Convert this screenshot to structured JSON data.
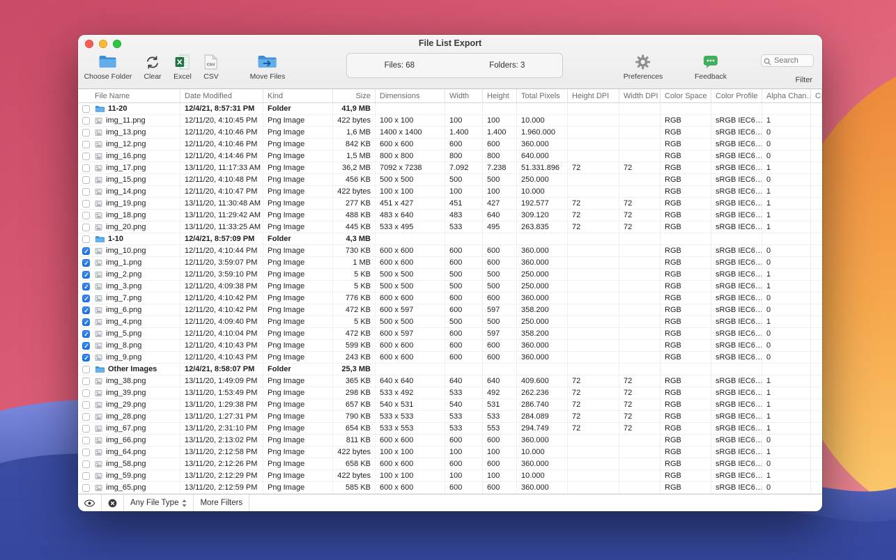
{
  "window": {
    "title": "File List Export",
    "toolbar": {
      "buttons": [
        {
          "label": "Choose Folder",
          "icon": "blue-folder-icon"
        },
        {
          "label": "Clear",
          "icon": "refresh-arrows-icon"
        },
        {
          "label": "Excel",
          "icon": "excel-document-icon"
        },
        {
          "label": "CSV",
          "icon": "csv-document-icon"
        },
        {
          "label": "Move Files",
          "icon": "blue-folder-arrow-icon"
        }
      ],
      "stats": {
        "files": "Files: 68",
        "folders": "Folders: 3"
      },
      "right_buttons": [
        {
          "label": "Preferences",
          "icon": "gear-icon"
        },
        {
          "label": "Feedback",
          "icon": "feedback-bubble-icon"
        }
      ],
      "search": {
        "placeholder": "Search",
        "icon": "magnifier-icon"
      },
      "filter_label": "Filter"
    },
    "table": {
      "columns": [
        "File Name",
        "Date Modified",
        "Kind",
        "Size",
        "Dimensions",
        "Width",
        "Height",
        "Total Pixels",
        "Height DPI",
        "Width DPI",
        "Color Space",
        "Color Profile",
        "Alpha Chan…",
        "Cr…"
      ],
      "rows": [
        {
          "type": "folder",
          "checked": false,
          "name": "11-20",
          "date": "12/4/21, 8:57:31 PM",
          "kind": "Folder",
          "size": "41,9 MB",
          "dim": "",
          "w": "",
          "h": "",
          "px": "",
          "hdpi": "",
          "wdpi": "",
          "cs": "",
          "cp": "",
          "alpha": ""
        },
        {
          "type": "file",
          "checked": false,
          "name": "img_11.png",
          "date": "12/11/20, 4:10:45 PM",
          "kind": "Png Image",
          "size": "422 bytes",
          "dim": "100 x 100",
          "w": "100",
          "h": "100",
          "px": "10.000",
          "hdpi": "",
          "wdpi": "",
          "cs": "RGB",
          "cp": "sRGB IEC6…",
          "alpha": "1"
        },
        {
          "type": "file",
          "checked": false,
          "name": "img_13.png",
          "date": "12/11/20, 4:10:46 PM",
          "kind": "Png Image",
          "size": "1,6 MB",
          "dim": "1400 x 1400",
          "w": "1.400",
          "h": "1.400",
          "px": "1.960.000",
          "hdpi": "",
          "wdpi": "",
          "cs": "RGB",
          "cp": "sRGB IEC6…",
          "alpha": "0"
        },
        {
          "type": "file",
          "checked": false,
          "name": "img_12.png",
          "date": "12/11/20, 4:10:46 PM",
          "kind": "Png Image",
          "size": "842 KB",
          "dim": "600 x 600",
          "w": "600",
          "h": "600",
          "px": "360.000",
          "hdpi": "",
          "wdpi": "",
          "cs": "RGB",
          "cp": "sRGB IEC6…",
          "alpha": "0"
        },
        {
          "type": "file",
          "checked": false,
          "name": "img_16.png",
          "date": "12/11/20, 4:14:46 PM",
          "kind": "Png Image",
          "size": "1,5 MB",
          "dim": "800 x 800",
          "w": "800",
          "h": "800",
          "px": "640.000",
          "hdpi": "",
          "wdpi": "",
          "cs": "RGB",
          "cp": "sRGB IEC6…",
          "alpha": "0"
        },
        {
          "type": "file",
          "checked": false,
          "name": "img_17.png",
          "date": "13/11/20, 11:17:33 AM",
          "kind": "Png Image",
          "size": "36,2 MB",
          "dim": "7092 x 7238",
          "w": "7.092",
          "h": "7.238",
          "px": "51.331.896",
          "hdpi": "72",
          "wdpi": "72",
          "cs": "RGB",
          "cp": "sRGB IEC6…",
          "alpha": "1"
        },
        {
          "type": "file",
          "checked": false,
          "name": "img_15.png",
          "date": "12/11/20, 4:10:48 PM",
          "kind": "Png Image",
          "size": "456 KB",
          "dim": "500 x 500",
          "w": "500",
          "h": "500",
          "px": "250.000",
          "hdpi": "",
          "wdpi": "",
          "cs": "RGB",
          "cp": "sRGB IEC6…",
          "alpha": "0"
        },
        {
          "type": "file",
          "checked": false,
          "name": "img_14.png",
          "date": "12/11/20, 4:10:47 PM",
          "kind": "Png Image",
          "size": "422 bytes",
          "dim": "100 x 100",
          "w": "100",
          "h": "100",
          "px": "10.000",
          "hdpi": "",
          "wdpi": "",
          "cs": "RGB",
          "cp": "sRGB IEC6…",
          "alpha": "1"
        },
        {
          "type": "file",
          "checked": false,
          "name": "img_19.png",
          "date": "13/11/20, 11:30:48 AM",
          "kind": "Png Image",
          "size": "277 KB",
          "dim": "451 x 427",
          "w": "451",
          "h": "427",
          "px": "192.577",
          "hdpi": "72",
          "wdpi": "72",
          "cs": "RGB",
          "cp": "sRGB IEC6…",
          "alpha": "1"
        },
        {
          "type": "file",
          "checked": false,
          "name": "img_18.png",
          "date": "13/11/20, 11:29:42 AM",
          "kind": "Png Image",
          "size": "488 KB",
          "dim": "483 x 640",
          "w": "483",
          "h": "640",
          "px": "309.120",
          "hdpi": "72",
          "wdpi": "72",
          "cs": "RGB",
          "cp": "sRGB IEC6…",
          "alpha": "1"
        },
        {
          "type": "file",
          "checked": false,
          "name": "img_20.png",
          "date": "13/11/20, 11:33:25 AM",
          "kind": "Png Image",
          "size": "445 KB",
          "dim": "533 x 495",
          "w": "533",
          "h": "495",
          "px": "263.835",
          "hdpi": "72",
          "wdpi": "72",
          "cs": "RGB",
          "cp": "sRGB IEC6…",
          "alpha": "1"
        },
        {
          "type": "folder",
          "checked": false,
          "name": "1-10",
          "date": "12/4/21, 8:57:09 PM",
          "kind": "Folder",
          "size": "4,3 MB",
          "dim": "",
          "w": "",
          "h": "",
          "px": "",
          "hdpi": "",
          "wdpi": "",
          "cs": "",
          "cp": "",
          "alpha": ""
        },
        {
          "type": "file",
          "checked": true,
          "name": "img_10.png",
          "date": "12/11/20, 4:10:44 PM",
          "kind": "Png Image",
          "size": "730 KB",
          "dim": "600 x 600",
          "w": "600",
          "h": "600",
          "px": "360.000",
          "hdpi": "",
          "wdpi": "",
          "cs": "RGB",
          "cp": "sRGB IEC6…",
          "alpha": "0"
        },
        {
          "type": "file",
          "checked": true,
          "name": "img_1.png",
          "date": "12/11/20, 3:59:07 PM",
          "kind": "Png Image",
          "size": "1 MB",
          "dim": "600 x 600",
          "w": "600",
          "h": "600",
          "px": "360.000",
          "hdpi": "",
          "wdpi": "",
          "cs": "RGB",
          "cp": "sRGB IEC6…",
          "alpha": "0"
        },
        {
          "type": "file",
          "checked": true,
          "name": "img_2.png",
          "date": "12/11/20, 3:59:10 PM",
          "kind": "Png Image",
          "size": "5 KB",
          "dim": "500 x 500",
          "w": "500",
          "h": "500",
          "px": "250.000",
          "hdpi": "",
          "wdpi": "",
          "cs": "RGB",
          "cp": "sRGB IEC6…",
          "alpha": "1"
        },
        {
          "type": "file",
          "checked": true,
          "name": "img_3.png",
          "date": "12/11/20, 4:09:38 PM",
          "kind": "Png Image",
          "size": "5 KB",
          "dim": "500 x 500",
          "w": "500",
          "h": "500",
          "px": "250.000",
          "hdpi": "",
          "wdpi": "",
          "cs": "RGB",
          "cp": "sRGB IEC6…",
          "alpha": "1"
        },
        {
          "type": "file",
          "checked": true,
          "name": "img_7.png",
          "date": "12/11/20, 4:10:42 PM",
          "kind": "Png Image",
          "size": "776 KB",
          "dim": "600 x 600",
          "w": "600",
          "h": "600",
          "px": "360.000",
          "hdpi": "",
          "wdpi": "",
          "cs": "RGB",
          "cp": "sRGB IEC6…",
          "alpha": "0"
        },
        {
          "type": "file",
          "checked": true,
          "name": "img_6.png",
          "date": "12/11/20, 4:10:42 PM",
          "kind": "Png Image",
          "size": "472 KB",
          "dim": "600 x 597",
          "w": "600",
          "h": "597",
          "px": "358.200",
          "hdpi": "",
          "wdpi": "",
          "cs": "RGB",
          "cp": "sRGB IEC6…",
          "alpha": "0"
        },
        {
          "type": "file",
          "checked": true,
          "name": "img_4.png",
          "date": "12/11/20, 4:09:40 PM",
          "kind": "Png Image",
          "size": "5 KB",
          "dim": "500 x 500",
          "w": "500",
          "h": "500",
          "px": "250.000",
          "hdpi": "",
          "wdpi": "",
          "cs": "RGB",
          "cp": "sRGB IEC6…",
          "alpha": "1"
        },
        {
          "type": "file",
          "checked": true,
          "name": "img_5.png",
          "date": "12/11/20, 4:10:04 PM",
          "kind": "Png Image",
          "size": "472 KB",
          "dim": "600 x 597",
          "w": "600",
          "h": "597",
          "px": "358.200",
          "hdpi": "",
          "wdpi": "",
          "cs": "RGB",
          "cp": "sRGB IEC6…",
          "alpha": "0"
        },
        {
          "type": "file",
          "checked": true,
          "name": "img_8.png",
          "date": "12/11/20, 4:10:43 PM",
          "kind": "Png Image",
          "size": "599 KB",
          "dim": "600 x 600",
          "w": "600",
          "h": "600",
          "px": "360.000",
          "hdpi": "",
          "wdpi": "",
          "cs": "RGB",
          "cp": "sRGB IEC6…",
          "alpha": "0"
        },
        {
          "type": "file",
          "checked": true,
          "name": "img_9.png",
          "date": "12/11/20, 4:10:43 PM",
          "kind": "Png Image",
          "size": "243 KB",
          "dim": "600 x 600",
          "w": "600",
          "h": "600",
          "px": "360.000",
          "hdpi": "",
          "wdpi": "",
          "cs": "RGB",
          "cp": "sRGB IEC6…",
          "alpha": "0"
        },
        {
          "type": "folder",
          "checked": false,
          "name": "Other Images",
          "date": "12/4/21, 8:58:07 PM",
          "kind": "Folder",
          "size": "25,3 MB",
          "dim": "",
          "w": "",
          "h": "",
          "px": "",
          "hdpi": "",
          "wdpi": "",
          "cs": "",
          "cp": "",
          "alpha": ""
        },
        {
          "type": "file",
          "checked": false,
          "name": "img_38.png",
          "date": "13/11/20, 1:49:09 PM",
          "kind": "Png Image",
          "size": "365 KB",
          "dim": "640 x 640",
          "w": "640",
          "h": "640",
          "px": "409.600",
          "hdpi": "72",
          "wdpi": "72",
          "cs": "RGB",
          "cp": "sRGB IEC6…",
          "alpha": "1"
        },
        {
          "type": "file",
          "checked": false,
          "name": "img_39.png",
          "date": "13/11/20, 1:53:49 PM",
          "kind": "Png Image",
          "size": "298 KB",
          "dim": "533 x 492",
          "w": "533",
          "h": "492",
          "px": "262.236",
          "hdpi": "72",
          "wdpi": "72",
          "cs": "RGB",
          "cp": "sRGB IEC6…",
          "alpha": "1"
        },
        {
          "type": "file",
          "checked": false,
          "name": "img_29.png",
          "date": "13/11/20, 1:29:38 PM",
          "kind": "Png Image",
          "size": "657 KB",
          "dim": "540 x 531",
          "w": "540",
          "h": "531",
          "px": "286.740",
          "hdpi": "72",
          "wdpi": "72",
          "cs": "RGB",
          "cp": "sRGB IEC6…",
          "alpha": "1"
        },
        {
          "type": "file",
          "checked": false,
          "name": "img_28.png",
          "date": "13/11/20, 1:27:31 PM",
          "kind": "Png Image",
          "size": "790 KB",
          "dim": "533 x 533",
          "w": "533",
          "h": "533",
          "px": "284.089",
          "hdpi": "72",
          "wdpi": "72",
          "cs": "RGB",
          "cp": "sRGB IEC6…",
          "alpha": "1"
        },
        {
          "type": "file",
          "checked": false,
          "name": "img_67.png",
          "date": "13/11/20, 2:31:10 PM",
          "kind": "Png Image",
          "size": "654 KB",
          "dim": "533 x 553",
          "w": "533",
          "h": "553",
          "px": "294.749",
          "hdpi": "72",
          "wdpi": "72",
          "cs": "RGB",
          "cp": "sRGB IEC6…",
          "alpha": "1"
        },
        {
          "type": "file",
          "checked": false,
          "name": "img_66.png",
          "date": "13/11/20, 2:13:02 PM",
          "kind": "Png Image",
          "size": "811 KB",
          "dim": "600 x 600",
          "w": "600",
          "h": "600",
          "px": "360.000",
          "hdpi": "",
          "wdpi": "",
          "cs": "RGB",
          "cp": "sRGB IEC6…",
          "alpha": "0"
        },
        {
          "type": "file",
          "checked": false,
          "name": "img_64.png",
          "date": "13/11/20, 2:12:58 PM",
          "kind": "Png Image",
          "size": "422 bytes",
          "dim": "100 x 100",
          "w": "100",
          "h": "100",
          "px": "10.000",
          "hdpi": "",
          "wdpi": "",
          "cs": "RGB",
          "cp": "sRGB IEC6…",
          "alpha": "1"
        },
        {
          "type": "file",
          "checked": false,
          "name": "img_58.png",
          "date": "13/11/20, 2:12:26 PM",
          "kind": "Png Image",
          "size": "658 KB",
          "dim": "600 x 600",
          "w": "600",
          "h": "600",
          "px": "360.000",
          "hdpi": "",
          "wdpi": "",
          "cs": "RGB",
          "cp": "sRGB IEC6…",
          "alpha": "0"
        },
        {
          "type": "file",
          "checked": false,
          "name": "img_59.png",
          "date": "13/11/20, 2:12:29 PM",
          "kind": "Png Image",
          "size": "422 bytes",
          "dim": "100 x 100",
          "w": "100",
          "h": "100",
          "px": "10.000",
          "hdpi": "",
          "wdpi": "",
          "cs": "RGB",
          "cp": "sRGB IEC6…",
          "alpha": "1"
        },
        {
          "type": "file",
          "checked": false,
          "name": "img_65.png",
          "date": "13/11/20, 2:12:59 PM",
          "kind": "Png Image",
          "size": "585 KB",
          "dim": "600 x 600",
          "w": "600",
          "h": "600",
          "px": "360.000",
          "hdpi": "",
          "wdpi": "",
          "cs": "RGB",
          "cp": "sRGB IEC6…",
          "alpha": "0"
        }
      ]
    },
    "statusbar": {
      "file_type": "Any File Type",
      "more_filters": "More Filters",
      "icons": [
        "eye-icon",
        "clear-filter-icon",
        "updown-chevrons-icon"
      ]
    },
    "colors": {
      "accent_blue": "#1a6ee6",
      "folder_blue": "#459de0",
      "excel_green": "#1e7145"
    }
  }
}
